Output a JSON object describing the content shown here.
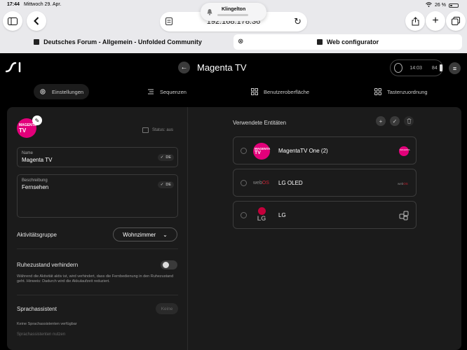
{
  "status_bar": {
    "time": "17:44",
    "date": "Mittwoch 29. Apr.",
    "battery": "26 %"
  },
  "notification": {
    "label": "Klingelton"
  },
  "safari": {
    "url": "192.168.178.36",
    "tabs": [
      {
        "label": "Deutsches Forum - Allgemein - Unfolded Community"
      },
      {
        "label": "Web configurator"
      }
    ]
  },
  "header": {
    "title": "Magenta TV",
    "clock": "14:03",
    "battery_level": "84"
  },
  "nav": [
    {
      "label": "Einstellungen"
    },
    {
      "label": "Sequenzen"
    },
    {
      "label": "Benutzeroberfläche"
    },
    {
      "label": "Tastenzuordnung"
    }
  ],
  "activity": {
    "avatar_line1": "MAGENTA",
    "avatar_line2": "TV",
    "status": "Status: aus",
    "name_label": "Name",
    "name_value": "Magenta TV",
    "lang": "DE",
    "description_label": "Beschreibung",
    "description_value": "Fernsehen",
    "group_label": "Aktivitätsgruppe",
    "group_value": "Wohnzimmer",
    "standby_label": "Ruhezustand verhindern",
    "standby_desc": "Während die Aktivität aktiv ist, wird verhindert, dass die Fernbedienung in den Ruhezustand geht. Hinweis: Dadurch wird die Akkulaufzeit reduziert.",
    "assistant_label": "Sprachassistent",
    "assistant_button": "Keine",
    "assistant_note": "Keine Sprachassistenten verfügbar",
    "assistant_cutoff": "Sprachassistenten nutzen"
  },
  "entities": {
    "title": "Verwendete Entitäten",
    "items": [
      {
        "name": "MagentaTV One (2)"
      },
      {
        "name": "LG OLED",
        "logo_prefix": "web",
        "logo_suffix": "OS"
      },
      {
        "name": "LG",
        "logo_text": "LG"
      }
    ]
  },
  "colors": {
    "brand": "#e2007a",
    "panel": "#1b1b1b",
    "background": "#000000"
  }
}
